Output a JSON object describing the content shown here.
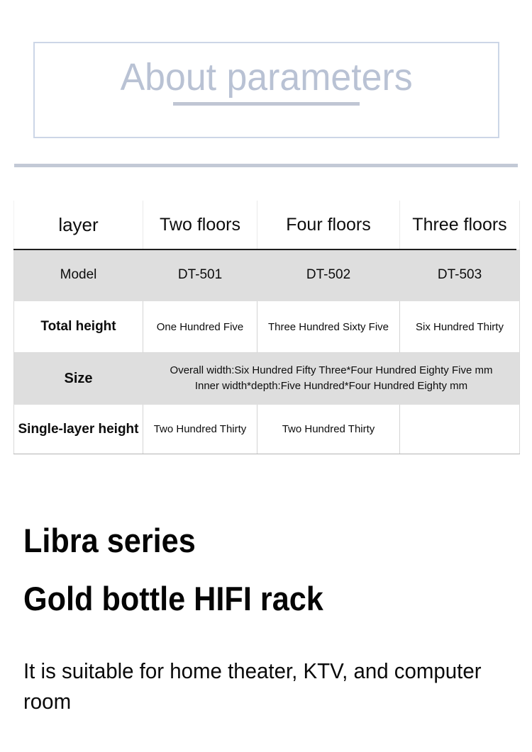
{
  "banner": {
    "title": "About parameters"
  },
  "table": {
    "columns": [
      "layer",
      "Two floors",
      "Four floors",
      "Three floors"
    ],
    "rows": [
      {
        "label": "Model",
        "values": [
          "DT-501",
          "DT-502",
          "DT-503"
        ],
        "shaded": true
      },
      {
        "label": "Total height",
        "values": [
          "One Hundred  Five",
          "Three Hundred Sixty Five",
          "Six Hundred Thirty"
        ],
        "shaded": false
      },
      {
        "label": "Size",
        "span_lines": [
          "Overall width:Six Hundred Fifty Three*Four Hundred Eighty Five mm",
          "Inner width*depth:Five Hundred*Four Hundred Eighty mm"
        ],
        "shaded": true
      },
      {
        "label": "Single-layer height",
        "values": [
          "Two Hundred Thirty",
          "Two Hundred Thirty",
          ""
        ],
        "shaded": false
      }
    ]
  },
  "product": {
    "headline_line1": "Libra series",
    "headline_line2": "Gold bottle HIFI rack",
    "description": "It is suitable for home theater, KTV, and computer room"
  },
  "colors": {
    "banner_border": "#ccd6e7",
    "banner_text": "#b9c2d4",
    "accent_rule": "#c3c9d6",
    "row_shade": "#dedede",
    "header_rule": "#1d1d1d"
  }
}
